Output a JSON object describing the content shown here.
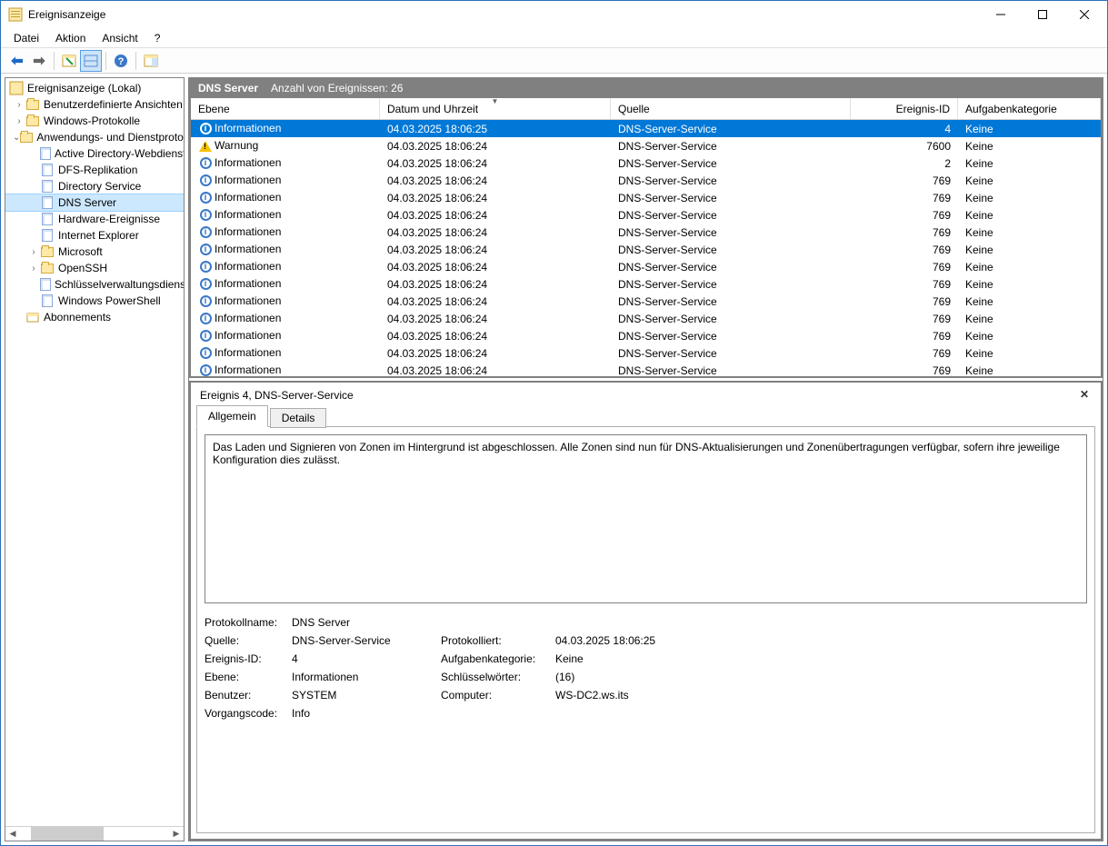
{
  "titlebar": {
    "title": "Ereignisanzeige"
  },
  "menu": {
    "file": "Datei",
    "action": "Aktion",
    "view": "Ansicht",
    "help": "?"
  },
  "tree": {
    "root": "Ereignisanzeige (Lokal)",
    "custom_views": "Benutzerdefinierte Ansichten",
    "windows_logs": "Windows-Protokolle",
    "app_services": "Anwendungs- und Dienstprotokolle",
    "items": {
      "ad": "Active Directory-Webdienste",
      "dfs": "DFS-Replikation",
      "ds": "Directory Service",
      "dns": "DNS Server",
      "hw": "Hardware-Ereignisse",
      "ie": "Internet Explorer",
      "ms": "Microsoft",
      "ssh": "OpenSSH",
      "key": "Schlüsselverwaltungsdienst",
      "ps": "Windows PowerShell"
    },
    "subs": "Abonnements"
  },
  "header": {
    "title": "DNS Server",
    "count_label": "Anzahl von Ereignissen: 26"
  },
  "columns": {
    "level": "Ebene",
    "date": "Datum und Uhrzeit",
    "source": "Quelle",
    "id": "Ereignis-ID",
    "category": "Aufgabenkategorie"
  },
  "levels": {
    "info": "Informationen",
    "warn": "Warnung"
  },
  "rows": [
    {
      "lvl": "info",
      "dt": "04.03.2025 18:06:25",
      "src": "DNS-Server-Service",
      "id": "4",
      "cat": "Keine",
      "sel": true
    },
    {
      "lvl": "warn",
      "dt": "04.03.2025 18:06:24",
      "src": "DNS-Server-Service",
      "id": "7600",
      "cat": "Keine"
    },
    {
      "lvl": "info",
      "dt": "04.03.2025 18:06:24",
      "src": "DNS-Server-Service",
      "id": "2",
      "cat": "Keine"
    },
    {
      "lvl": "info",
      "dt": "04.03.2025 18:06:24",
      "src": "DNS-Server-Service",
      "id": "769",
      "cat": "Keine"
    },
    {
      "lvl": "info",
      "dt": "04.03.2025 18:06:24",
      "src": "DNS-Server-Service",
      "id": "769",
      "cat": "Keine"
    },
    {
      "lvl": "info",
      "dt": "04.03.2025 18:06:24",
      "src": "DNS-Server-Service",
      "id": "769",
      "cat": "Keine"
    },
    {
      "lvl": "info",
      "dt": "04.03.2025 18:06:24",
      "src": "DNS-Server-Service",
      "id": "769",
      "cat": "Keine"
    },
    {
      "lvl": "info",
      "dt": "04.03.2025 18:06:24",
      "src": "DNS-Server-Service",
      "id": "769",
      "cat": "Keine"
    },
    {
      "lvl": "info",
      "dt": "04.03.2025 18:06:24",
      "src": "DNS-Server-Service",
      "id": "769",
      "cat": "Keine"
    },
    {
      "lvl": "info",
      "dt": "04.03.2025 18:06:24",
      "src": "DNS-Server-Service",
      "id": "769",
      "cat": "Keine"
    },
    {
      "lvl": "info",
      "dt": "04.03.2025 18:06:24",
      "src": "DNS-Server-Service",
      "id": "769",
      "cat": "Keine"
    },
    {
      "lvl": "info",
      "dt": "04.03.2025 18:06:24",
      "src": "DNS-Server-Service",
      "id": "769",
      "cat": "Keine"
    },
    {
      "lvl": "info",
      "dt": "04.03.2025 18:06:24",
      "src": "DNS-Server-Service",
      "id": "769",
      "cat": "Keine"
    },
    {
      "lvl": "info",
      "dt": "04.03.2025 18:06:24",
      "src": "DNS-Server-Service",
      "id": "769",
      "cat": "Keine"
    },
    {
      "lvl": "info",
      "dt": "04.03.2025 18:06:24",
      "src": "DNS-Server-Service",
      "id": "769",
      "cat": "Keine"
    }
  ],
  "detail": {
    "title": "Ereignis 4, DNS-Server-Service",
    "tabs": {
      "general": "Allgemein",
      "details": "Details"
    },
    "message": "Das Laden und Signieren von Zonen im Hintergrund ist abgeschlossen. Alle Zonen sind nun für DNS-Aktualisierungen und Zonenübertragungen verfügbar, sofern ihre jeweilige Konfiguration dies zulässt.",
    "labels": {
      "log": "Protokollname:",
      "source": "Quelle:",
      "logged": "Protokolliert:",
      "eid": "Ereignis-ID:",
      "taskcat": "Aufgabenkategorie:",
      "level": "Ebene:",
      "keywords": "Schlüsselwörter:",
      "user": "Benutzer:",
      "computer": "Computer:",
      "opcode": "Vorgangscode:"
    },
    "values": {
      "log": "DNS Server",
      "source": "DNS-Server-Service",
      "logged": "04.03.2025 18:06:25",
      "eid": "4",
      "taskcat": "Keine",
      "level": "Informationen",
      "keywords": "(16)",
      "user": "SYSTEM",
      "computer": "WS-DC2.ws.its",
      "opcode": "Info"
    }
  }
}
